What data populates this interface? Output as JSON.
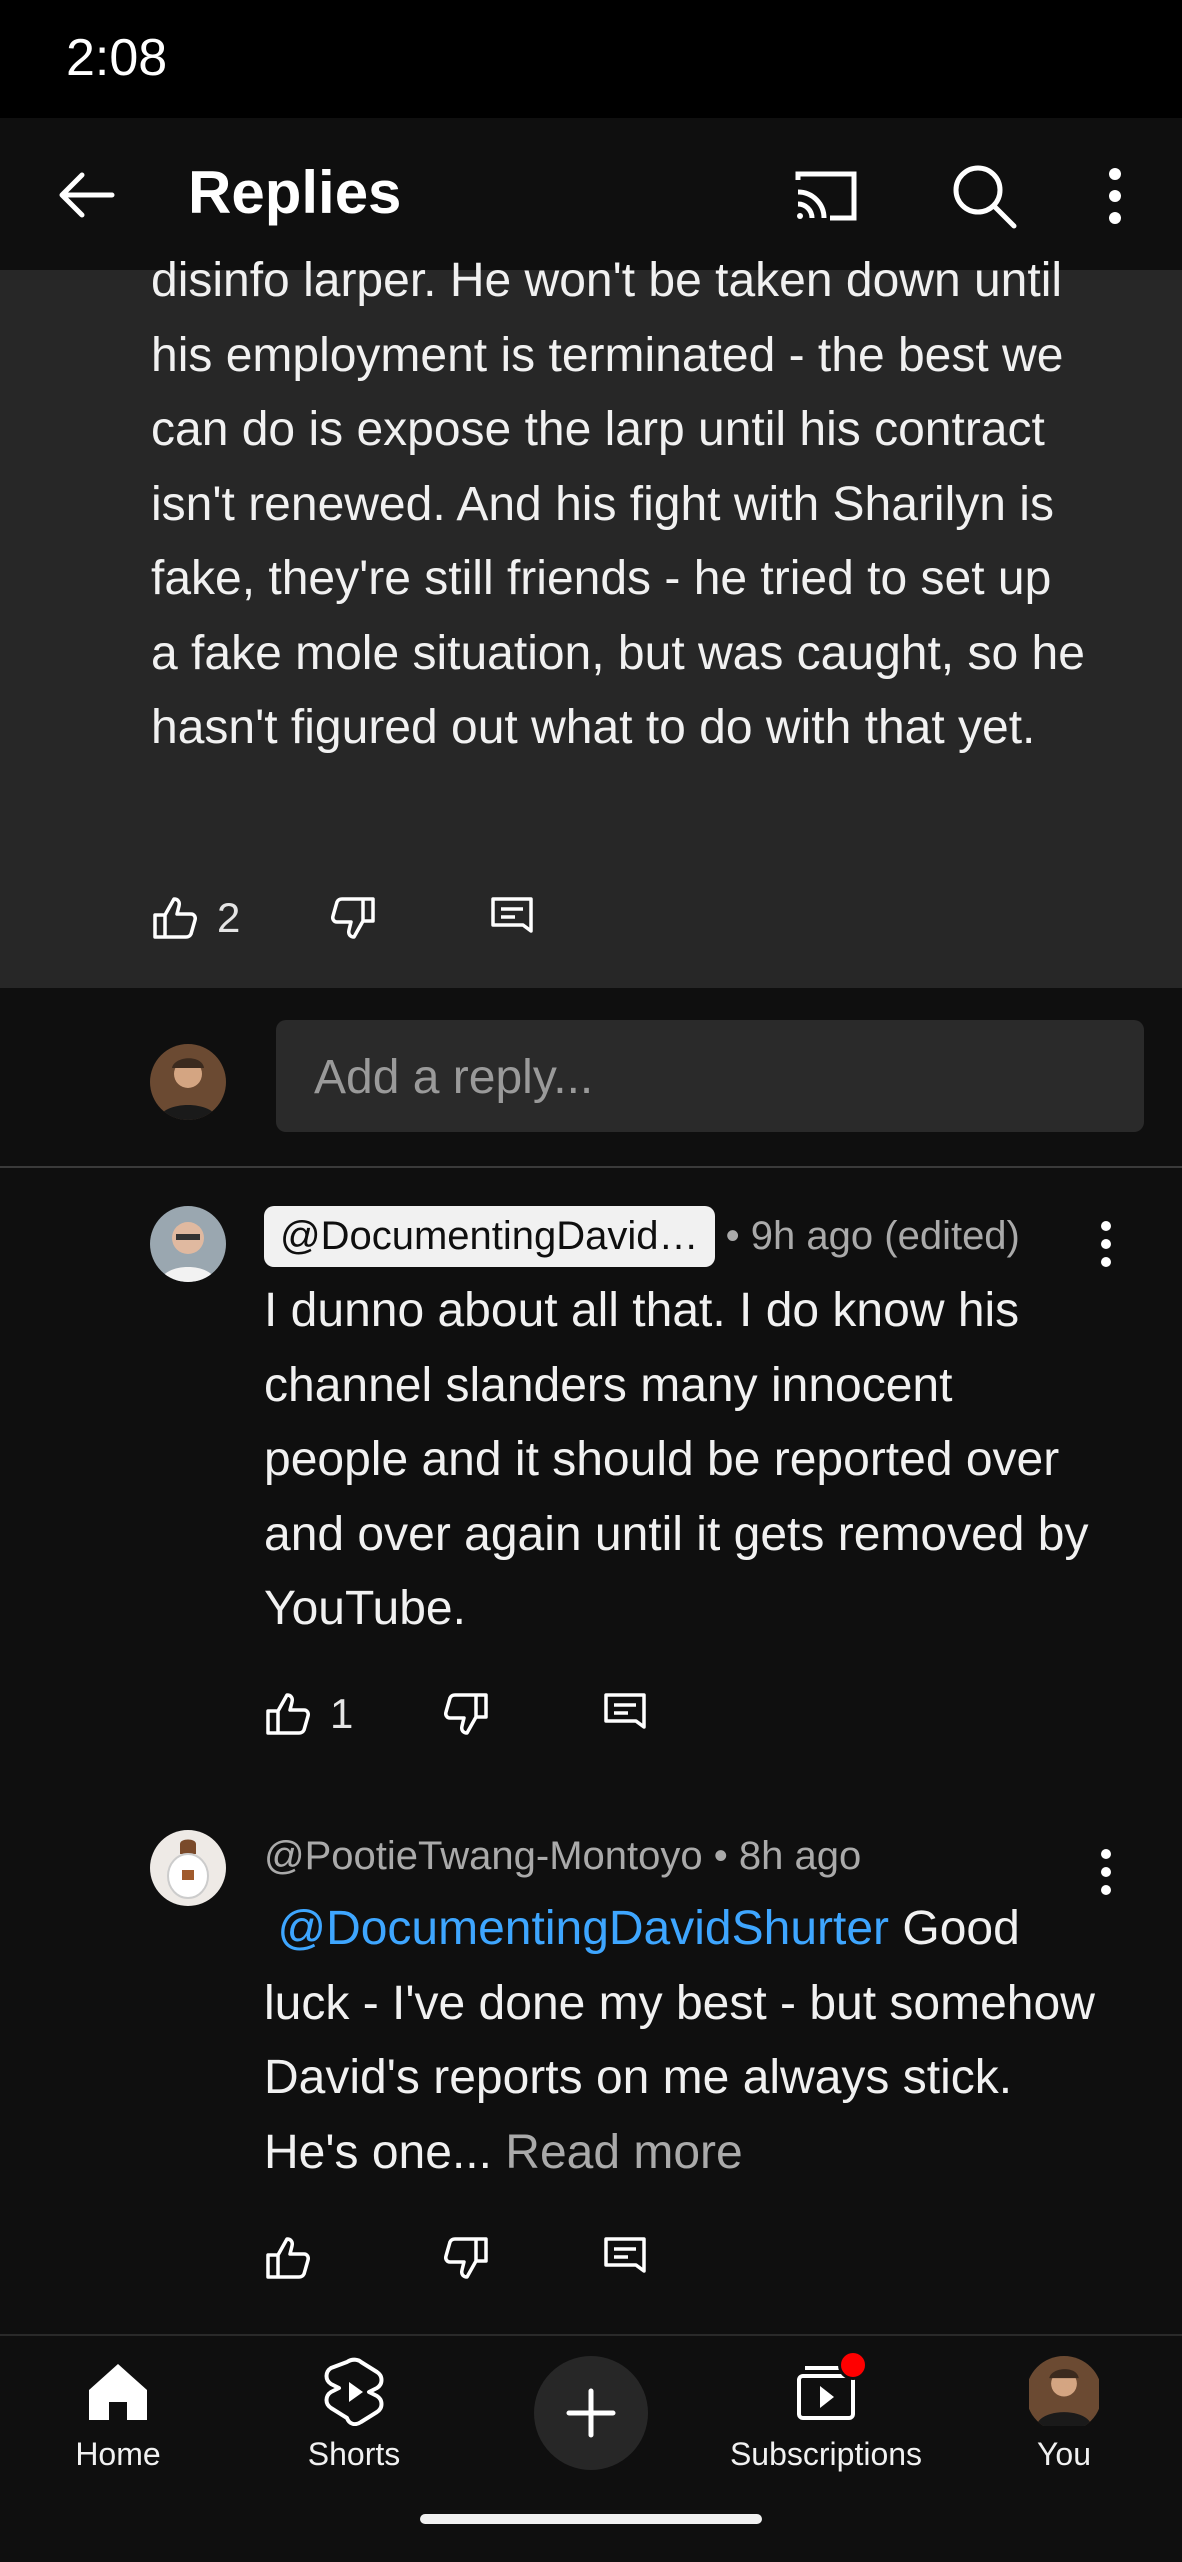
{
  "status_bar": {
    "time": "2:08"
  },
  "header": {
    "title": "Replies"
  },
  "parent_comment": {
    "text": "disinfo larper. He won't be taken down until his employment is terminated - the best we can do is expose the larp until his contract isn't renewed. And his fight with Sharilyn is fake, they're still friends - he tried to set up a fake mole situation, but was caught, so he hasn't figured out what to do with that yet.",
    "like_count": "2"
  },
  "reply_input": {
    "placeholder": "Add a reply..."
  },
  "replies": [
    {
      "author": "@DocumentingDavid…",
      "meta": " • 9h ago (edited)",
      "text": "I dunno about all that. I do know his channel slanders many innocent people and it should be reported over and over again until it gets removed by YouTube.",
      "like_count": "1"
    },
    {
      "author": "@PootieTwang-Montoyo",
      "meta": " • 8h ago",
      "mention": "@DocumentingDavidShurter",
      "text": " Good luck - I've done my best - but somehow David's reports on me always stick. He's one...",
      "read_more": " Read more",
      "like_count": ""
    }
  ],
  "bottom_nav": {
    "home": "Home",
    "shorts": "Shorts",
    "subscriptions": "Subscriptions",
    "you": "You"
  },
  "colors": {
    "background": "#0f0f0f",
    "parent_bg": "#272727",
    "mention": "#3ea6ff",
    "notification_dot": "#ff0000"
  }
}
